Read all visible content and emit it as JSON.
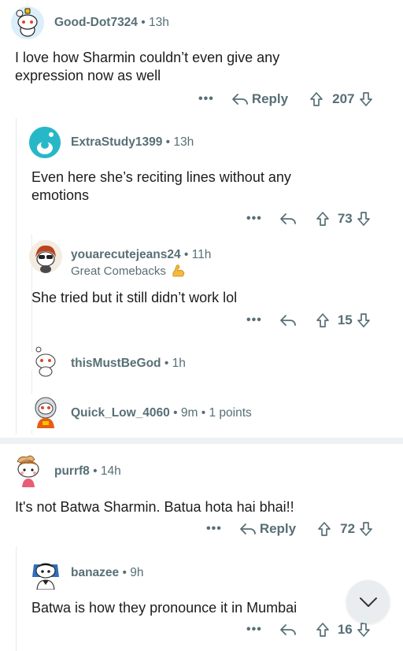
{
  "comments": [
    {
      "username": "Good-Dot7324",
      "time": "13h",
      "text_lines": [
        "I love how Sharmin couldn’t even give any",
        "expression now as well"
      ],
      "actions": {
        "more": "•••",
        "reply": "Reply",
        "votes": "207"
      }
    },
    {
      "username": "ExtraStudy1399",
      "time": "13h",
      "text_lines": [
        "Even here she’s reciting lines without any",
        "emotions"
      ],
      "actions": {
        "more": "•••",
        "votes": "73"
      }
    },
    {
      "username": "youarecutejeans24",
      "time": "11h",
      "flair": "Great Comebacks",
      "text_lines": [
        "She tried but it still didn’t work lol"
      ],
      "actions": {
        "more": "•••",
        "votes": "15"
      }
    },
    {
      "username": "thisMustBeGod",
      "time": "1h"
    },
    {
      "username": "Quick_Low_4060",
      "time": "9m",
      "points": "1 points"
    },
    {
      "username": "purrf8",
      "time": "14h",
      "text_lines": [
        "It's not Batwa Sharmin. Batua hota hai bhai!!"
      ],
      "actions": {
        "more": "•••",
        "reply": "Reply",
        "votes": "72"
      }
    },
    {
      "username": "banazee",
      "time": "9h",
      "text_lines": [
        "Batwa is how they pronounce it in Mumbai"
      ],
      "actions": {
        "more": "•••",
        "votes": "16"
      }
    }
  ],
  "separator": "•",
  "icons": {
    "reply": "reply-arrow-icon",
    "upvote": "upvote-arrow-icon",
    "downvote": "downvote-arrow-icon",
    "scroll": "chevron-down-icon",
    "flair": "flexed-biceps-icon"
  },
  "colors": {
    "text": "#1c1c1c",
    "meta": "#576f76",
    "thread_line": "#e5ebee",
    "divider": "#eef1f3"
  }
}
